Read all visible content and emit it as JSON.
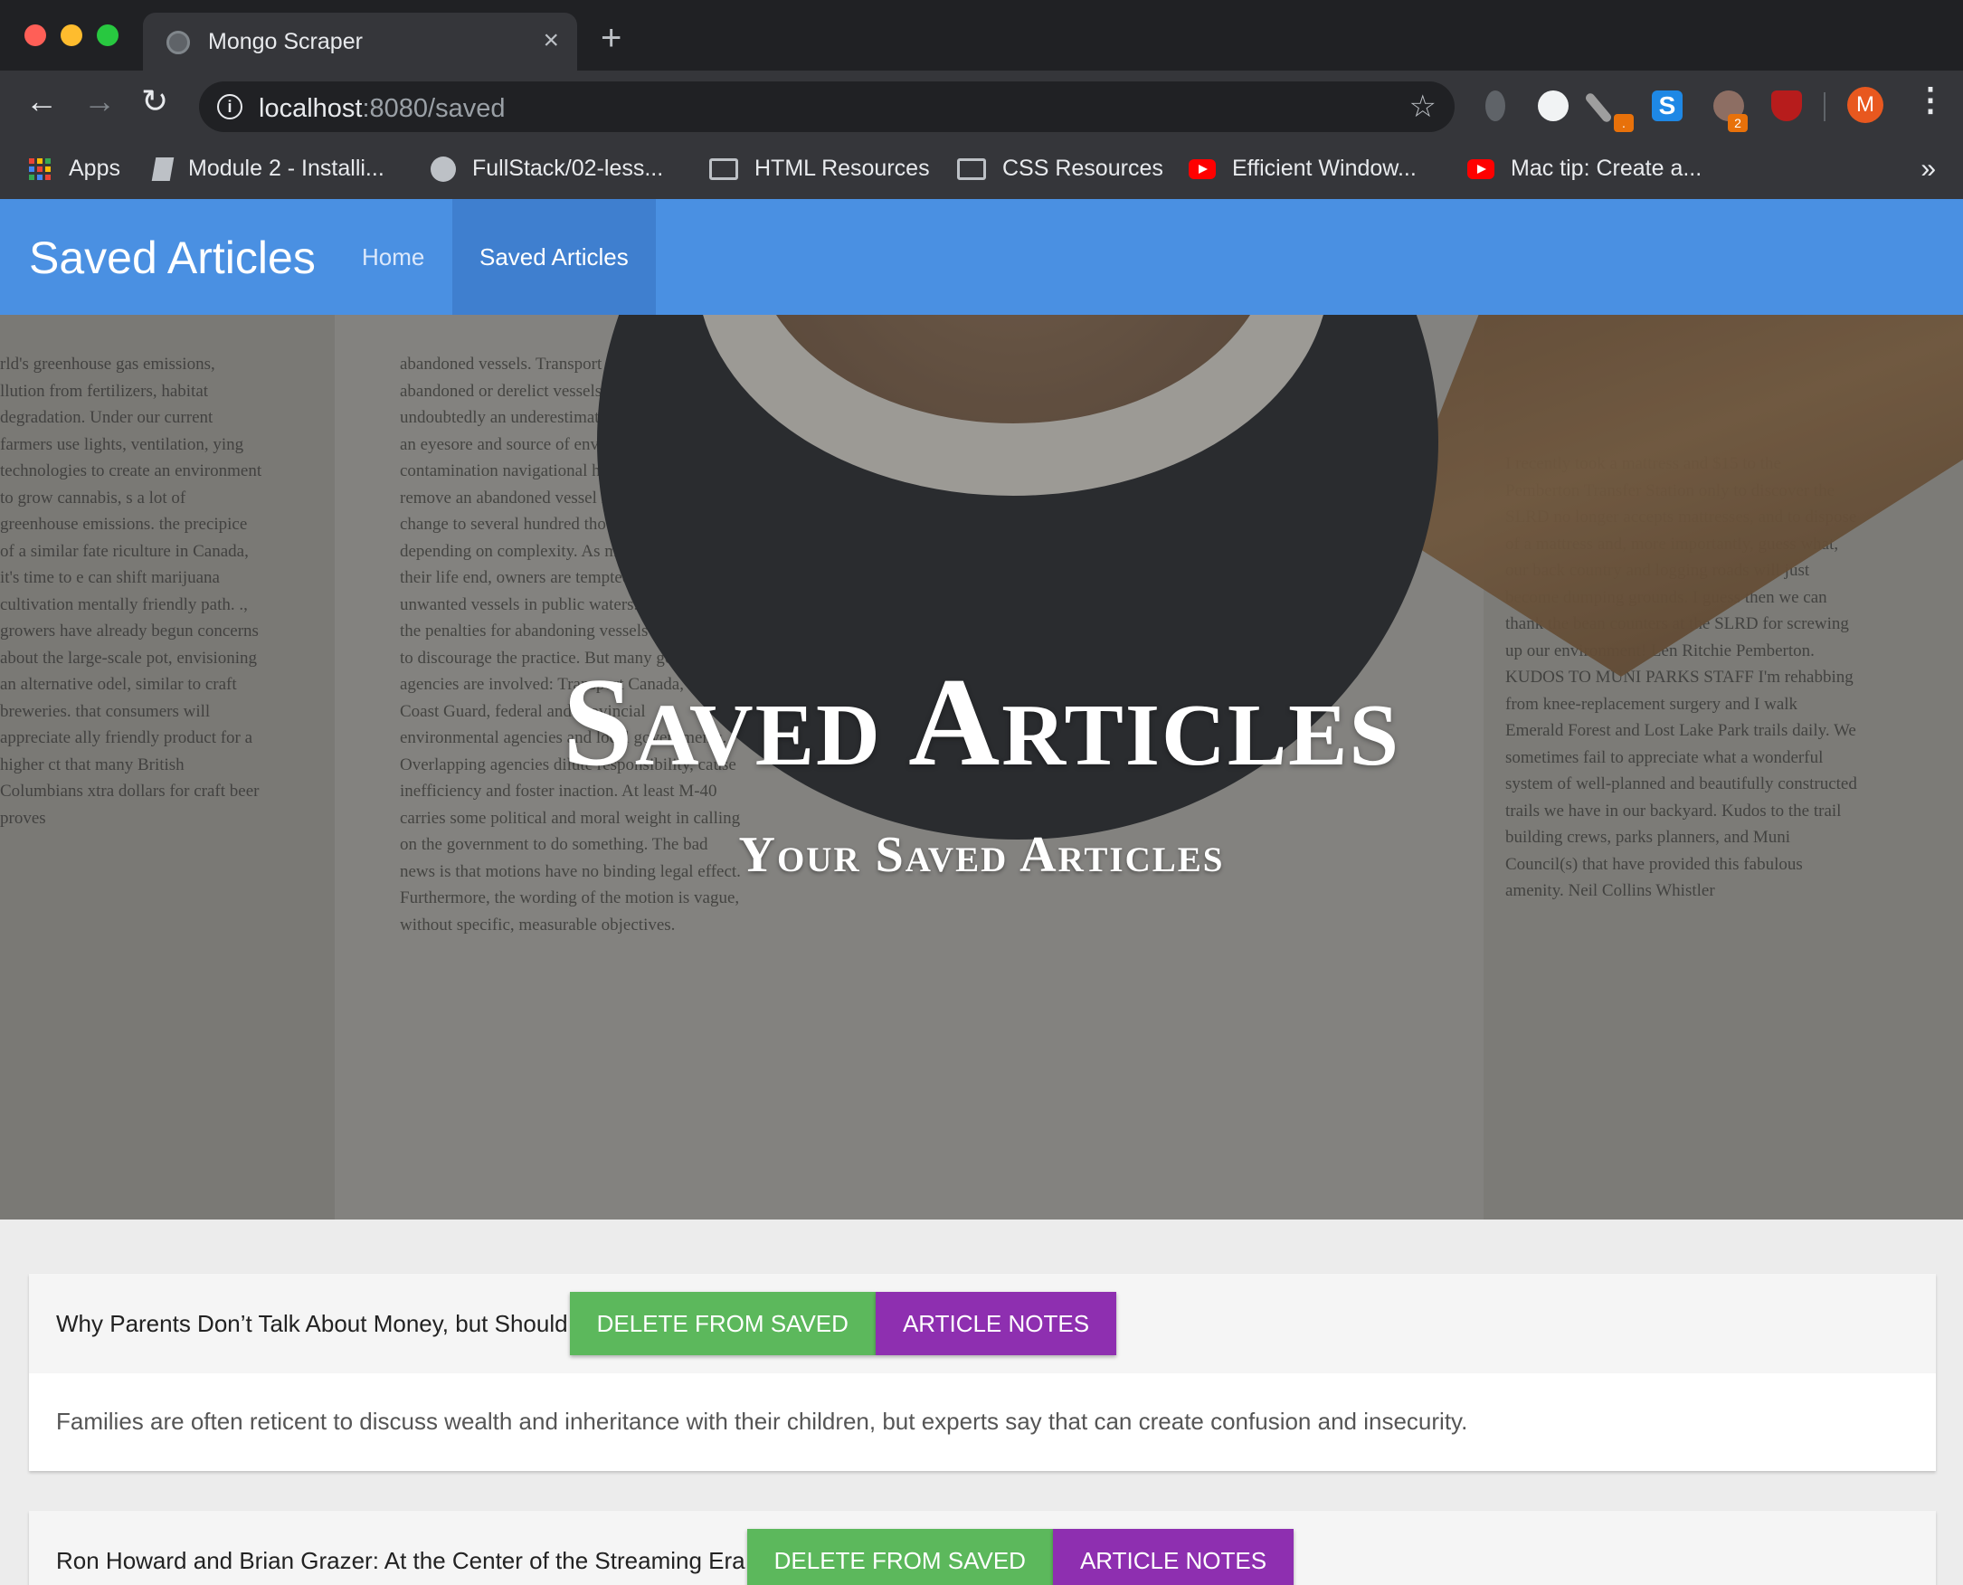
{
  "browser": {
    "tab_title": "Mongo Scraper",
    "tab_close": "×",
    "new_tab": "+",
    "url_host": "localhost",
    "url_path": ":8080/saved",
    "avatar_letter": "M",
    "ext_s_label": "S",
    "badge_a": ".",
    "badge_b": "2",
    "bookmarks": [
      {
        "label": "Apps",
        "icon": "apps-icon"
      },
      {
        "label": "Module 2 - Installi...",
        "icon": "book-icon"
      },
      {
        "label": "FullStack/02-less...",
        "icon": "github-icon"
      },
      {
        "label": "HTML Resources",
        "icon": "folder-icon"
      },
      {
        "label": "CSS Resources",
        "icon": "folder-icon"
      },
      {
        "label": "Efficient Window...",
        "icon": "youtube-icon"
      },
      {
        "label": "Mac tip: Create a...",
        "icon": "youtube-icon"
      }
    ],
    "bookmarks_more": "»"
  },
  "navbar": {
    "brand": "Saved Articles",
    "links": [
      "Home",
      "Saved Articles"
    ]
  },
  "hero": {
    "title": "Saved Articles",
    "subtitle": "Your Saved Articles",
    "newspaper_left": "rld's greenhouse gas emissions, llution from fertilizers, habitat degradation. Under our current farmers use lights, ventilation, ying technologies to create an environment to grow cannabis, s a lot of greenhouse emissions. the precipice of a similar fate riculture in Canada, it's time to e can shift marijuana cultivation mentally friendly path. ., growers have already begun concerns about the large-scale pot, envisioning an alternative odel, similar to craft breweries. that consumers will appreciate ally friendly product for a higher ct that many British Columbians xtra dollars for craft beer proves",
    "newspaper_mid": "abandoned vessels. Transport Canada has abandoned or derelict vessels waters, undoubtedly an underestimate. Each is, at least, an eyesore and source of environmental contamination navigational hazard. The cost to remove an abandoned vessel ranges from small change to several hundred thousand dollars, depending on complexity. As many old boats near their life end, owners are tempted to dump unwanted vessels in public waters. land found at the penalties for abandoning vessels are needed to discourage the practice. But many government agencies are involved: Transport Canada, the Coast Guard, federal and provincial environmental agencies and local governments. Overlapping agencies dilute responsibility, cause inefficiency and foster inaction. At least M-40 carries some political and moral weight in calling on the government to do something. The bad news is that motions have no binding legal effect. Furthermore, the wording of the motion is vague, without specific, measurable objectives.",
    "newspaper_right": "I recently took a mattress and $15 to the Pemberton Transfer Station only to discover the SLRD no longer accepts mattresses, and to dispose of a mattress and, more importantly, guess what, our back country and logging roads will just become dumping grounds. I guess then we can thank the bean counters at the SLRD for screwing up our environment! Len Ritchie Pemberton. KUDOS TO MUNI PARKS STAFF I'm rehabbing from knee-replacement surgery and I walk Emerald Forest and Lost Lake Park trails daily. We sometimes fail to appreciate what a wonderful system of well-planned and beautifully constructed trails we have in our backyard. Kudos to the trail building crews, parks planners, and Muni Council(s) that have provided this fabulous amenity. Neil Collins Whistler"
  },
  "articles": [
    {
      "title": "Why Parents Don’t Talk About Money, but Should",
      "delete_label": "Delete From Saved",
      "notes_label": "Article Notes",
      "summary": "Families are often reticent to discuss wealth and inheritance with their children, but experts say that can create confusion and insecurity."
    },
    {
      "title": "Ron Howard and Brian Grazer: At the Center of the Streaming Era",
      "delete_label": "Delete From Saved",
      "notes_label": "Article Notes",
      "summary": ""
    }
  ],
  "colors": {
    "navbar": "#4a90e2",
    "delete_button": "#5cb85c",
    "notes_button": "#8e2fb0"
  }
}
